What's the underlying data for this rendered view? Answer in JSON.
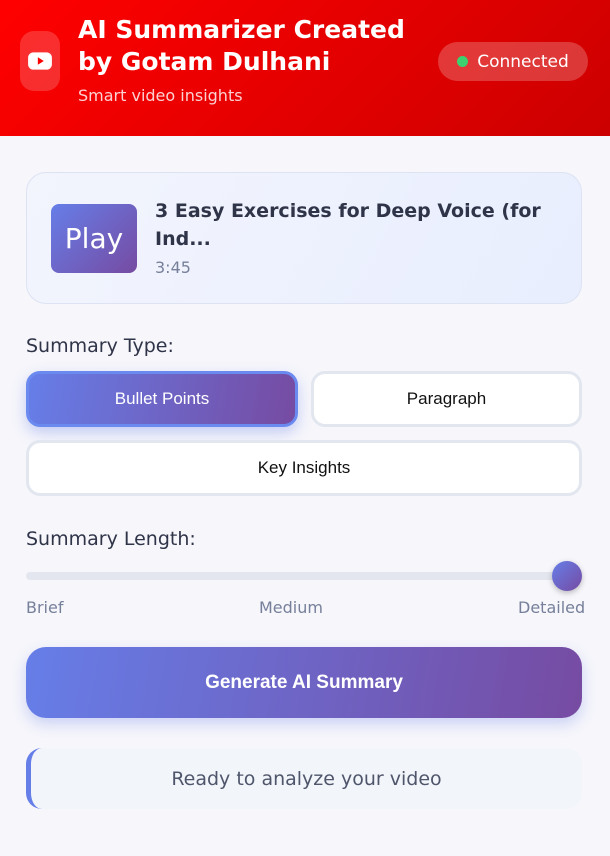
{
  "header": {
    "title": "AI Summarizer Created by Gotam Dulhani",
    "subtitle": "Smart video insights",
    "status": "Connected"
  },
  "video": {
    "thumb_label": "Play",
    "title": "3 Easy Exercises for Deep Voice (for Ind...",
    "duration": "3:45"
  },
  "summary_type": {
    "label": "Summary Type:",
    "options": [
      "Bullet Points",
      "Paragraph",
      "Key Insights"
    ],
    "selected": "Bullet Points"
  },
  "summary_length": {
    "label": "Summary Length:",
    "ticks": [
      "Brief",
      "Medium",
      "Detailed"
    ],
    "value": 1.0
  },
  "actions": {
    "generate": "Generate AI Summary"
  },
  "status_message": "Ready to analyze your video",
  "colors": {
    "header": "#ff0000",
    "accent_start": "#667ee8",
    "accent_end": "#764ba2",
    "status_dot": "#3dd16f"
  }
}
